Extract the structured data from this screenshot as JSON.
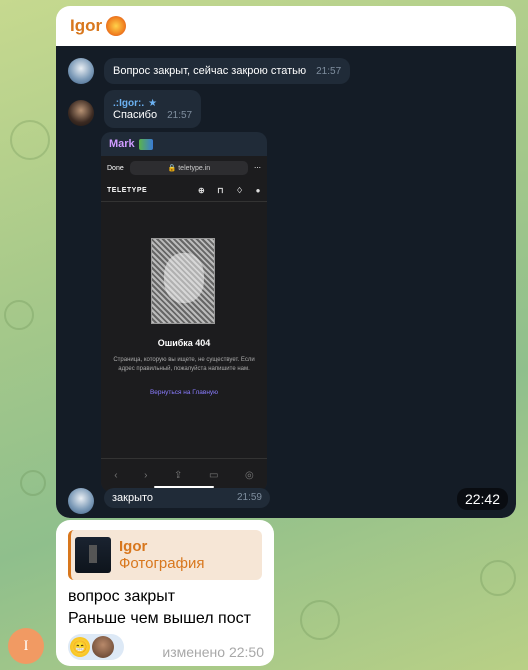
{
  "top_bubble": {
    "sender": "Igor",
    "messages": [
      {
        "text": "Вопрос закрыт, сейчас закрою статью",
        "time": "21:57"
      },
      {
        "sender": ".:Igor:.",
        "text": "Спасибо",
        "time": "21:57"
      }
    ],
    "forward": {
      "sender": "Mark",
      "screenshot": {
        "done": "Done",
        "url": "🔒 teletype.in",
        "brand": "TELETYPE",
        "error_title": "Ошибка 404",
        "error_text": "Страница, которую вы ищете, не существует. Если адрес правильный, пожалуйста напишите нам.",
        "link": "Вернуться на Главную"
      }
    },
    "last_message": {
      "text": "закрыто",
      "time": "21:59"
    },
    "time_badge": "22:42"
  },
  "bottom_bubble": {
    "reply_name": "Igor",
    "reply_type": "Фотография",
    "lines": [
      "вопрос закрыт",
      "Раньше чем вышел пост"
    ],
    "edited": "изменено 22:50"
  },
  "user_avatar_letter": "I"
}
